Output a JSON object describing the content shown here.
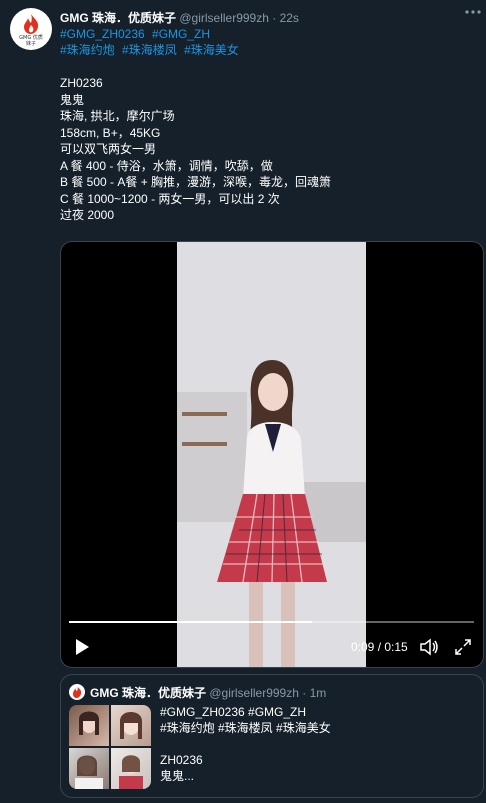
{
  "tweet": {
    "author_name": "GMG 珠海．优质妹子",
    "handle": "@girlseller999zh",
    "time": "· 22s",
    "more_icon": "more-dots-icon",
    "tags_line1": [
      "#GMG_ZH0236",
      "#GMG_ZH"
    ],
    "tags_line2": [
      "#珠海约炮",
      "#珠海楼凤",
      "#珠海美女"
    ],
    "body_lines": [
      "ZH0236",
      "鬼鬼",
      "珠海, 拱北，摩尔广场",
      "158cm, B+，45KG",
      "可以双飞两女一男",
      "A 餐 400 - 侍浴，水箫，调情，吹舔，做",
      "B 餐 500 - A餐 + 胸推，漫游，深喉，毒龙，回魂箫",
      "C 餐 1000~1200 - 两女一男，可以出 2 次",
      "过夜 2000"
    ]
  },
  "avatar": {
    "brand_line1": "GMG 优质",
    "brand_line2": "妹子",
    "accent": "#e0301e"
  },
  "video": {
    "time_display": "0:09 / 0:15",
    "progress": 0.6,
    "play_icon": "play-icon",
    "volume_icon": "volume-icon",
    "fullscreen_icon": "fullscreen-icon"
  },
  "quote": {
    "author_name": "GMG 珠海．优质妹子",
    "handle": "@girlseller999zh",
    "time": "· 1m",
    "lines": [
      "#GMG_ZH0236 #GMG_ZH",
      "#珠海约炮 #珠海楼凤 #珠海美女",
      "",
      "ZH0236",
      "鬼鬼..."
    ]
  },
  "colors": {
    "background": "#15202b",
    "link": "#1b95e0",
    "muted": "#8899a6",
    "border": "#38444d"
  }
}
